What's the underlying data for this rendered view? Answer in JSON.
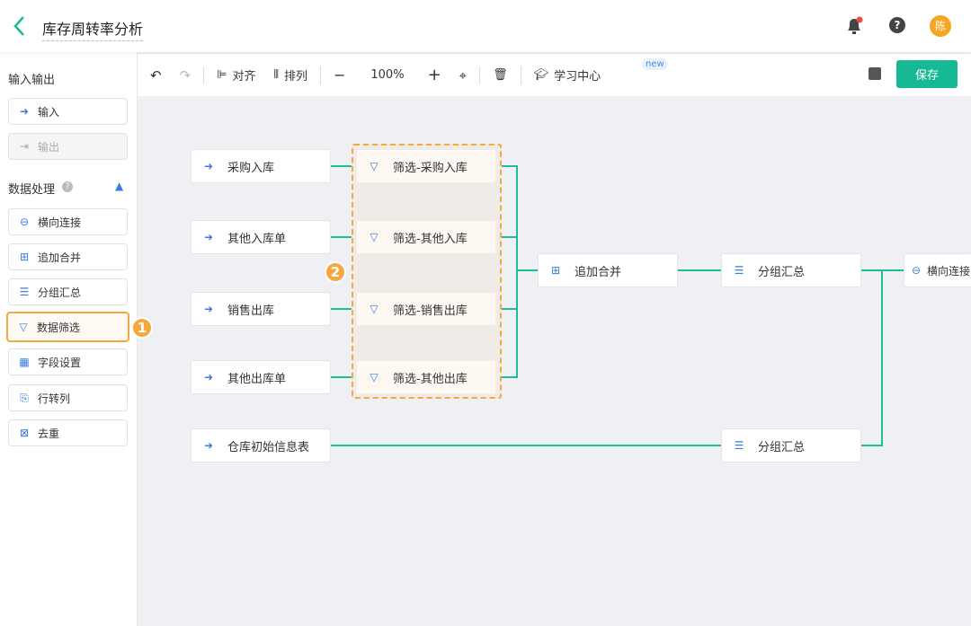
{
  "header": {
    "title": "库存周转率分析",
    "avatar": "陈",
    "icons": [
      "back-chevron-icon",
      "bell-icon",
      "help-icon"
    ]
  },
  "toolbar": {
    "align": "对齐",
    "arrange": "排列",
    "zoom": "100%",
    "learn": "学习中心",
    "new_badge": "new",
    "save": "保存"
  },
  "sidebar": {
    "section1": "输入输出",
    "io": [
      {
        "label": "输入",
        "icon": "input-icon"
      },
      {
        "label": "输出",
        "icon": "output-icon",
        "disabled": true
      }
    ],
    "section2": "数据处理",
    "proc": [
      {
        "label": "横向连接",
        "icon": "link-icon"
      },
      {
        "label": "追加合并",
        "icon": "merge-icon"
      },
      {
        "label": "分组汇总",
        "icon": "list-icon"
      },
      {
        "label": "数据筛选",
        "icon": "filter-icon",
        "selected": true
      },
      {
        "label": "字段设置",
        "icon": "table-icon"
      },
      {
        "label": "行转列",
        "icon": "pivot-icon"
      },
      {
        "label": "去重",
        "icon": "dedupe-icon"
      }
    ]
  },
  "badges": [
    "1",
    "2"
  ],
  "canvas": {
    "inputs": [
      "采购入库",
      "其他入库单",
      "销售出库",
      "其他出库单",
      "仓库初始信息表"
    ],
    "filters": [
      "筛选-采购入库",
      "筛选-其他入库",
      "筛选-销售出库",
      "筛选-其他出库"
    ],
    "merge": "追加合并",
    "group1": "分组汇总",
    "group2": "分组汇总",
    "join": "横向连接"
  },
  "colors": {
    "accent": "#17b994",
    "highlight": "#f5a742",
    "icon": "#3b7ddd"
  }
}
